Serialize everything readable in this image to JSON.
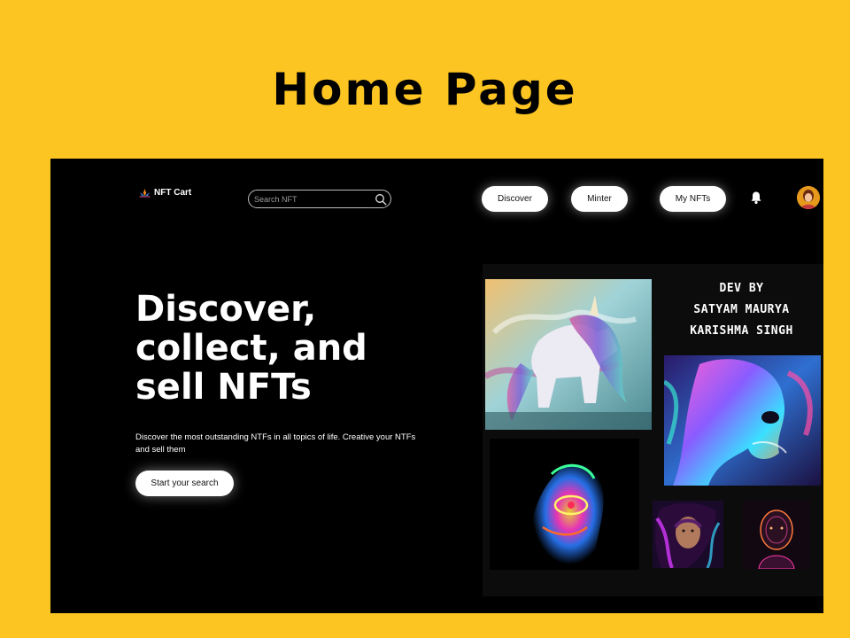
{
  "slide": {
    "title": "Home Page"
  },
  "header": {
    "brand": "NFT Cart",
    "search_placeholder": "Search NFT",
    "nav": [
      {
        "label": "Discover"
      },
      {
        "label": "Minter"
      },
      {
        "label": "My NFTs"
      }
    ]
  },
  "hero": {
    "title_lines": [
      "Discover,",
      "collect, and",
      "sell NFTs"
    ],
    "subtitle": "Discover the most outstanding NTFs in all topics of life. Creative your NTFs and sell them",
    "cta_label": "Start your search"
  },
  "gallery": {
    "credits": [
      "DEV BY",
      "SATYAM MAURYA",
      "KARISHMA SINGH"
    ]
  },
  "icons": {
    "logo": "lotus-logo-icon",
    "search": "search-icon",
    "notifications": "bell-icon"
  },
  "colors": {
    "slide_background": "#FDC522",
    "app_background": "#000000",
    "button_background": "#FFFFFF"
  }
}
